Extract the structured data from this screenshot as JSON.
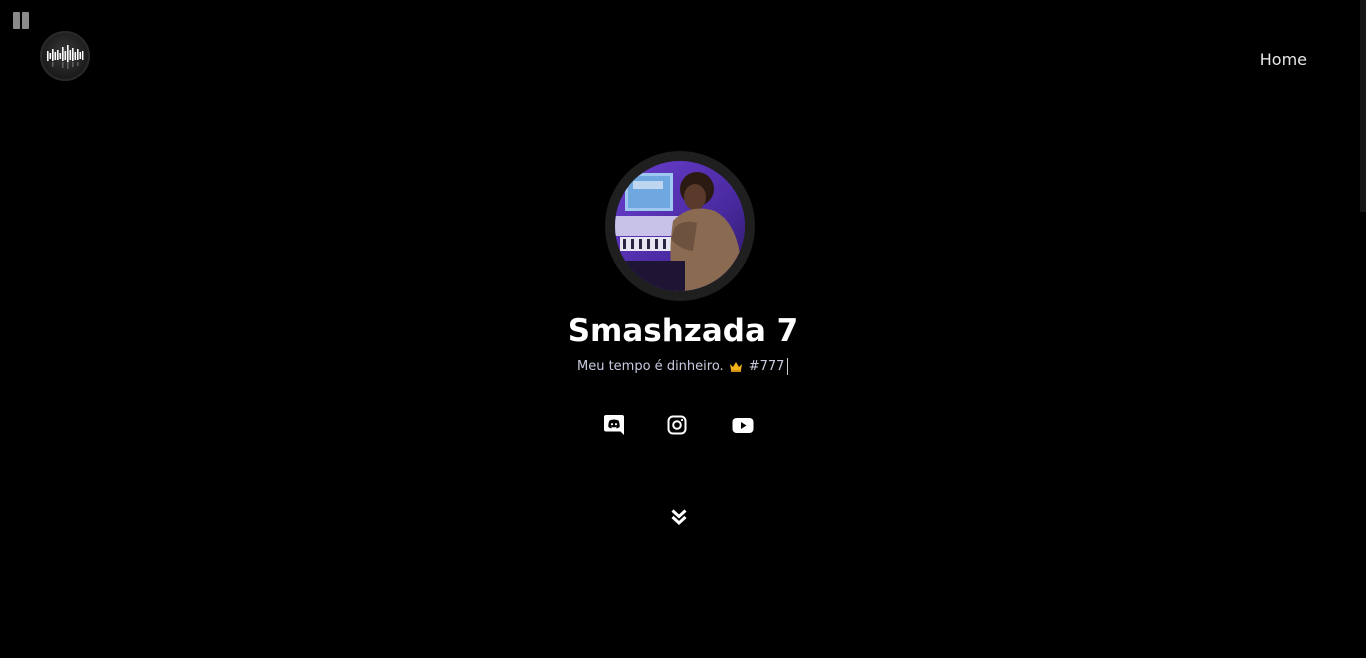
{
  "player": {
    "pause_icon": "pause-icon"
  },
  "header": {
    "logo_icon": "equalizer-logo-icon",
    "nav": {
      "home_label": "Home"
    }
  },
  "profile": {
    "avatar": "profile-photo",
    "name": "Smashzada 7",
    "bio_text": "Meu tempo é dinheiro.",
    "bio_emoji": "crown-icon",
    "bio_tag": "#777"
  },
  "socials": [
    {
      "icon": "discord-icon"
    },
    {
      "icon": "instagram-icon"
    },
    {
      "icon": "youtube-icon"
    }
  ],
  "scroll_icon": "double-chevron-down-icon",
  "colors": {
    "background": "#000000",
    "text": "#ffffff",
    "bio": "#c8cbe0",
    "avatar_ring": "#1f1f1f",
    "accent_purple": "#4b2aa0",
    "crown": "#f2b31a"
  }
}
